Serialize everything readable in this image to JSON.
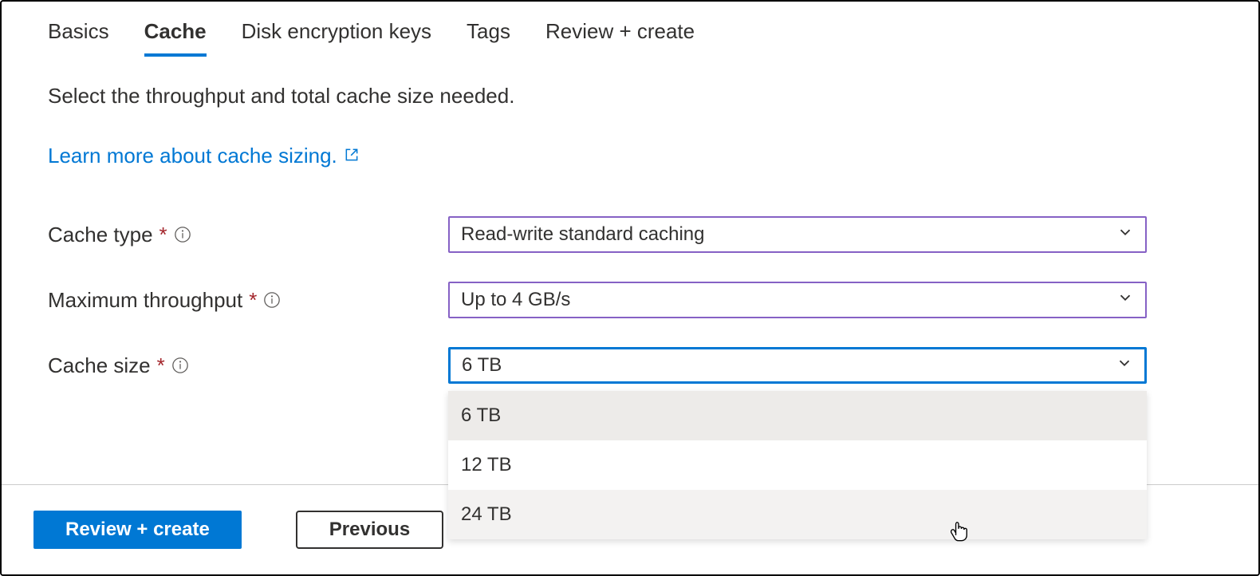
{
  "tabs": {
    "basics": "Basics",
    "cache": "Cache",
    "disk_encryption": "Disk encryption keys",
    "tags": "Tags",
    "review": "Review + create"
  },
  "description": "Select the throughput and total cache size needed.",
  "learn_more": "Learn more about cache sizing.",
  "form": {
    "cache_type": {
      "label": "Cache type",
      "value": "Read-write standard caching"
    },
    "maximum_throughput": {
      "label": "Maximum throughput",
      "value": "Up to 4 GB/s"
    },
    "cache_size": {
      "label": "Cache size",
      "value": "6 TB",
      "options": [
        "6 TB",
        "12 TB",
        "24 TB"
      ]
    }
  },
  "buttons": {
    "review_create": "Review + create",
    "previous": "Previous"
  }
}
